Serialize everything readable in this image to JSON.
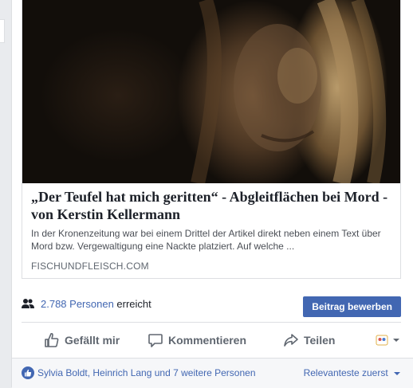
{
  "link_preview": {
    "title": "„Der Teufel hat mich geritten“ - Abgleitflächen bei Mord - von Kerstin Kellermann",
    "description": "In der Kronenzeitung war bei einem Drittel der Artikel direkt neben einem Text über Mord bzw. Vergewaltigung eine Nackte platziert. Auf welche ...",
    "domain": "FISCHUNDFLEISCH.COM"
  },
  "reach": {
    "count_label": "2.788 Personen",
    "suffix": "erreicht",
    "promote_button": "Beitrag bewerben"
  },
  "actions": {
    "like": "Gefällt mir",
    "comment": "Kommentieren",
    "share": "Teilen"
  },
  "footer": {
    "likers": "Sylvia Boldt, Heinrich Lang und 7 weitere Personen",
    "sort": "Relevanteste zuerst"
  },
  "colors": {
    "accent": "#4267b2",
    "text": "#1d2129",
    "muted": "#606770"
  },
  "icons": [
    "people-icon",
    "thumbs-up-icon",
    "comment-icon",
    "share-icon",
    "reaction-avatar-icon",
    "chevron-down-icon"
  ]
}
